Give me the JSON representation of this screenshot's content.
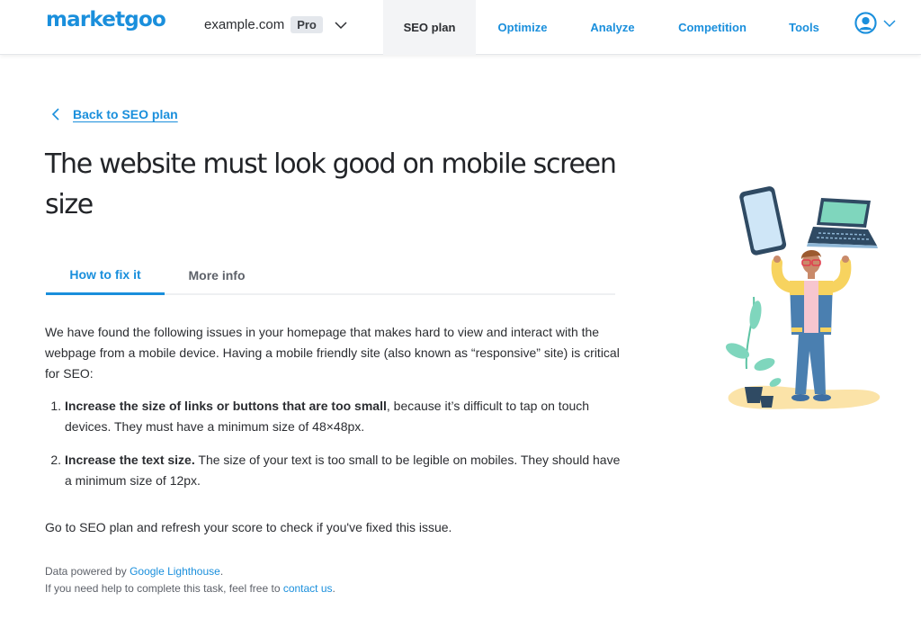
{
  "header": {
    "logo": "marketgoo",
    "domain": "example.com",
    "plan_badge": "Pro",
    "nav": [
      {
        "label": "SEO plan",
        "active": true
      },
      {
        "label": "Optimize",
        "active": false
      },
      {
        "label": "Analyze",
        "active": false
      },
      {
        "label": "Competition",
        "active": false
      },
      {
        "label": "Tools",
        "active": false
      }
    ],
    "icons": {
      "domain_dropdown": "chevron-down-icon",
      "account": "user-circle-icon",
      "account_dropdown": "chevron-down-icon"
    }
  },
  "back_link": {
    "label": "Back to SEO plan",
    "icon": "chevron-left-icon"
  },
  "page_title": "The website must look good on mobile screen size",
  "tabs": [
    {
      "label": "How to fix it",
      "active": true
    },
    {
      "label": "More info",
      "active": false
    }
  ],
  "content": {
    "intro": "We have found the following issues in your homepage that makes hard to view and interact with the webpage from a mobile device. Having a mobile friendly site (also known as “responsive” site) is critical for SEO:",
    "issues": [
      {
        "number": "1.",
        "bold": "Increase the size of links or buttons that are too small",
        "rest": ", because it’s difficult to tap on touch devices. They must have a minimum size of 48×48px."
      },
      {
        "number": "2.",
        "bold": "Increase the text size.",
        "rest": " The size of your text is too small to be legible on mobiles. They should have a minimum size of 12px."
      }
    ],
    "goto": "Go to SEO plan and refresh your score to check if you've fixed this issue."
  },
  "footer": {
    "powered_prefix": "Data powered by ",
    "powered_link": "Google Lighthouse",
    "powered_suffix": ".",
    "help_prefix": "If you need help to complete this task, feel free to ",
    "help_link": "contact us",
    "help_suffix": "."
  },
  "illustration": {
    "description": "person-with-phone-and-laptop-illustration"
  },
  "colors": {
    "brand": "#1a8fdc",
    "text": "#2b2d31",
    "muted": "#5d6169",
    "nav_active_bg": "#f3f4f6"
  }
}
